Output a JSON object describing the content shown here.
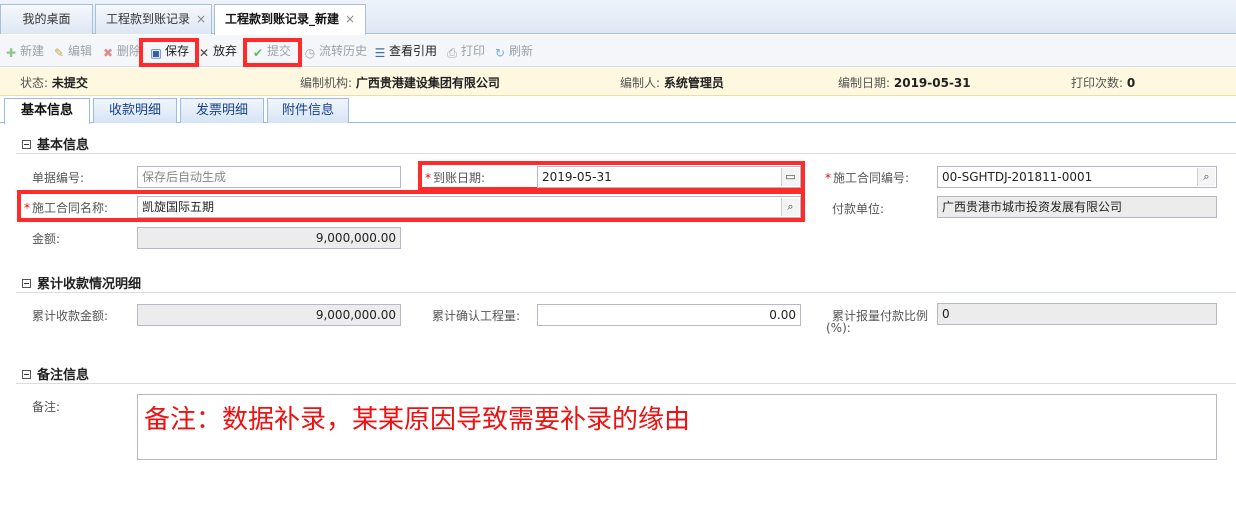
{
  "tabs": [
    {
      "label": "我的桌面"
    },
    {
      "label": "工程款到账记录"
    },
    {
      "label": "工程款到账记录_新建"
    }
  ],
  "tab_close_glyph": "×",
  "toolbar": {
    "new": "新建",
    "edit": "编辑",
    "delete": "删除",
    "save": "保存",
    "discard": "放弃",
    "submit": "提交",
    "flow_history": "流转历史",
    "view_ref": "查看引用",
    "print": "打印",
    "refresh": "刷新"
  },
  "status": {
    "state_label": "状态:",
    "state_value": "未提交",
    "org_label": "编制机构:",
    "org_value": "广西贵港建设集团有限公司",
    "author_label": "编制人:",
    "author_value": "系统管理员",
    "date_label": "编制日期:",
    "date_value": "2019-05-31",
    "print_label": "打印次数:",
    "print_value": "0"
  },
  "form_tabs": [
    "基本信息",
    "收款明细",
    "发票明细",
    "附件信息"
  ],
  "basic": {
    "title": "基本信息",
    "doc_no_label": "单据编号:",
    "doc_no_placeholder": "保存后自动生成",
    "arrival_date_label": "到账日期:",
    "arrival_date_value": "2019-05-31",
    "contract_no_label": "施工合同编号:",
    "contract_no_value": "00-SGHTDJ-201811-0001",
    "contract_name_label": "施工合同名称:",
    "contract_name_value": "凯旋国际五期",
    "payer_label": "付款单位:",
    "payer_value": "广西贵港市城市投资发展有限公司",
    "amount_label": "金额:",
    "amount_value": "9,000,000.00"
  },
  "cumulative": {
    "title": "累计收款情况明细",
    "received_label": "累计收款金额:",
    "received_value": "9,000,000.00",
    "confirmed_label": "累计确认工程量:",
    "confirmed_value": "0.00",
    "ratio_label_1": "累计报量付款比例",
    "ratio_label_2": "(%):",
    "ratio_value": "0"
  },
  "remark": {
    "title": "备注信息",
    "label": "备注:",
    "value": "备注：数据补录，某某原因导致需要补录的缘由"
  },
  "colors": {
    "highlight": "#ff2a2a",
    "remark_text": "#e11111",
    "status_bg": "#fdf8df"
  }
}
